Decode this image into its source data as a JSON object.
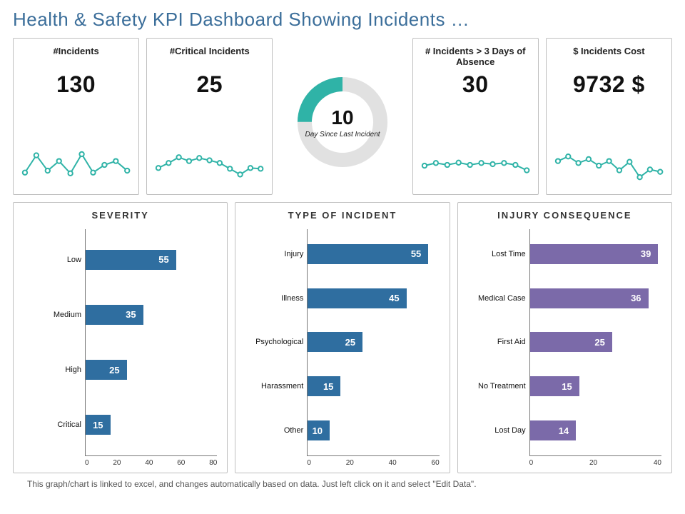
{
  "title": "Health & Safety KPI Dashboard Showing Incidents …",
  "colors": {
    "teal": "#2fb3a7",
    "blue": "#2f6ea0",
    "purple": "#7b6aa9",
    "donutBG": "#e1e1e1"
  },
  "kpis": {
    "incidents": {
      "label": "#Incidents",
      "value": "130",
      "spark": [
        30,
        75,
        35,
        60,
        28,
        78,
        30,
        50,
        60,
        35
      ]
    },
    "critical": {
      "label": "#Critical Incidents",
      "value": "25",
      "spark": [
        42,
        55,
        70,
        60,
        68,
        62,
        55,
        40,
        25,
        42,
        40
      ]
    },
    "absence": {
      "label": "# Incidents > 3 Days of Absence",
      "value": "30",
      "spark": [
        48,
        55,
        50,
        56,
        50,
        55,
        52,
        55,
        50,
        36
      ]
    },
    "cost": {
      "label": "$ Incidents Cost",
      "value": "9732 $",
      "spark": [
        60,
        72,
        55,
        65,
        48,
        60,
        36,
        58,
        18,
        38,
        32
      ]
    }
  },
  "donut": {
    "value": "10",
    "label": "Day Since Last Incident",
    "fillPct": 25
  },
  "footer": "This graph/chart is linked to excel, and changes automatically based on data. Just left click on it and select \"Edit Data\".",
  "chart_data": [
    {
      "type": "bar",
      "orientation": "horizontal",
      "title": "Severity",
      "categories": [
        "Low",
        "Medium",
        "High",
        "Critical"
      ],
      "values": [
        55,
        35,
        25,
        15
      ],
      "xlim": [
        0,
        80
      ],
      "ticks": [
        0,
        20,
        40,
        60,
        80
      ],
      "color": "#2f6ea0"
    },
    {
      "type": "bar",
      "orientation": "horizontal",
      "title": "Type of Incident",
      "categories": [
        "Injury",
        "Illness",
        "Psychological",
        "Harassment",
        "Other"
      ],
      "values": [
        55,
        45,
        25,
        15,
        10
      ],
      "xlim": [
        0,
        60
      ],
      "ticks": [
        0,
        20,
        40,
        60
      ],
      "color": "#2f6ea0"
    },
    {
      "type": "bar",
      "orientation": "horizontal",
      "title": "Injury Consequence",
      "categories": [
        "Lost Time",
        "Medical Case",
        "First Aid",
        "No Treatment",
        "Lost Day"
      ],
      "values": [
        39,
        36,
        25,
        15,
        14
      ],
      "xlim": [
        0,
        40
      ],
      "ticks": [
        0,
        20,
        40
      ],
      "color": "#7b6aa9"
    }
  ]
}
